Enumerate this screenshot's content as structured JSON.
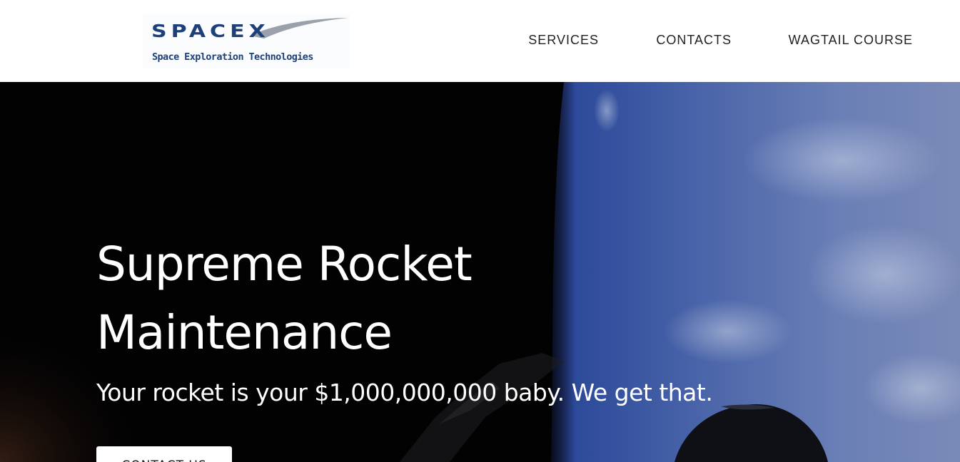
{
  "header": {
    "logo": {
      "wordmark": "SPACEX",
      "tagline": "Space Exploration Technologies",
      "color": "#1d3f7a"
    },
    "nav": [
      {
        "label": "SERVICES"
      },
      {
        "label": "CONTACTS"
      },
      {
        "label": "WAGTAIL COURSE"
      }
    ]
  },
  "hero": {
    "title_line1": "Supreme Rocket",
    "title_line2": "Maintenance",
    "subtitle": "Your rocket is your $1,000,000,000 baby. We get that.",
    "cta_label": "CONTACT US",
    "background_image": "earth-from-orbit-with-rocket-stage"
  }
}
